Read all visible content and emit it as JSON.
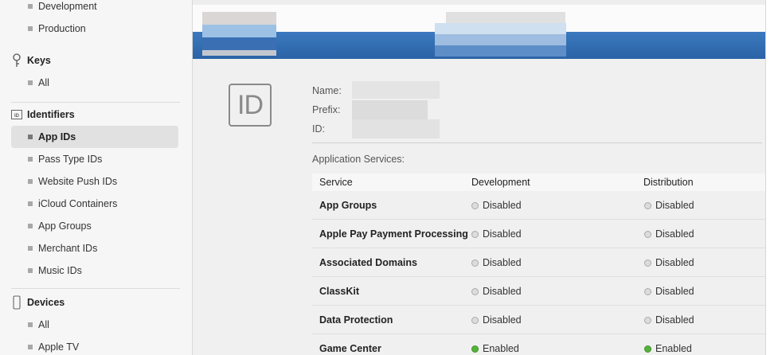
{
  "sidebar": {
    "certificates_items": [
      "Development",
      "Production"
    ],
    "keys": {
      "title": "Keys",
      "items": [
        "All"
      ]
    },
    "identifiers": {
      "title": "Identifiers",
      "items": [
        "App IDs",
        "Pass Type IDs",
        "Website Push IDs",
        "iCloud Containers",
        "App Groups",
        "Merchant IDs",
        "Music IDs"
      ],
      "selected": "App IDs"
    },
    "devices": {
      "title": "Devices",
      "items": [
        "All",
        "Apple TV"
      ]
    }
  },
  "detail": {
    "badge": "ID",
    "name_label": "Name:",
    "prefix_label": "Prefix:",
    "id_label": "ID:",
    "services_title": "Application Services:",
    "columns": [
      "Service",
      "Development",
      "Distribution"
    ],
    "services": [
      {
        "name": "App Groups",
        "development": "Disabled",
        "distribution": "Disabled"
      },
      {
        "name": "Apple Pay Payment Processing",
        "development": "Disabled",
        "distribution": "Disabled"
      },
      {
        "name": "Associated Domains",
        "development": "Disabled",
        "distribution": "Disabled"
      },
      {
        "name": "ClassKit",
        "development": "Disabled",
        "distribution": "Disabled"
      },
      {
        "name": "Data Protection",
        "development": "Disabled",
        "distribution": "Disabled"
      },
      {
        "name": "Game Center",
        "development": "Enabled",
        "distribution": "Enabled"
      }
    ]
  },
  "colors": {
    "accent": "#2b63a6",
    "enabled": "#55b33b",
    "disabled": "#dcdcdc"
  }
}
